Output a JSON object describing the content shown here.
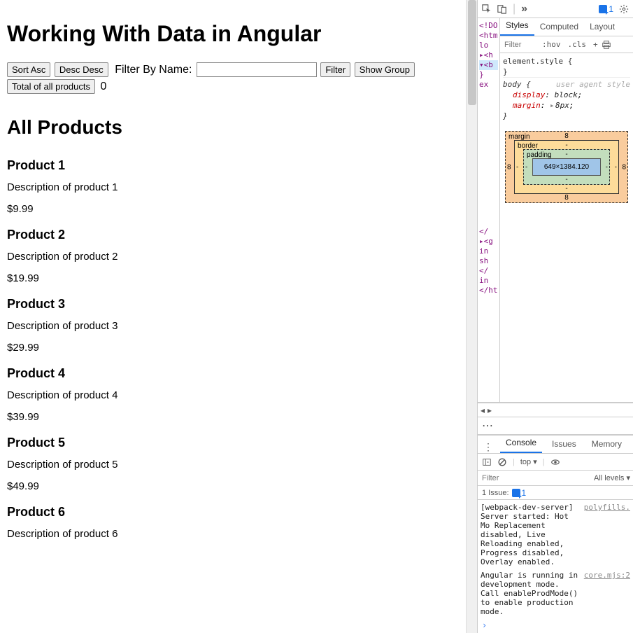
{
  "page": {
    "title": "Working With Data in Angular",
    "buttons": {
      "sortAsc": "Sort Asc",
      "sortDesc": "Desc Desc",
      "filter": "Filter",
      "showGroup": "Show Group",
      "total": "Total of all products"
    },
    "filterLabel": "Filter By Name:",
    "filterValue": "",
    "totalValue": "0",
    "heading": "All Products",
    "products": [
      {
        "name": "Product 1",
        "desc": "Description of product 1",
        "price": "$9.99"
      },
      {
        "name": "Product 2",
        "desc": "Description of product 2",
        "price": "$19.99"
      },
      {
        "name": "Product 3",
        "desc": "Description of product 3",
        "price": "$29.99"
      },
      {
        "name": "Product 4",
        "desc": "Description of product 4",
        "price": "$39.99"
      },
      {
        "name": "Product 5",
        "desc": "Description of product 5",
        "price": "$49.99"
      },
      {
        "name": "Product 6",
        "desc": "Description of product 6",
        "price": ""
      }
    ]
  },
  "devtools": {
    "issueCount": "1",
    "styleTabs": {
      "styles": "Styles",
      "computed": "Computed",
      "layout": "Layout"
    },
    "filterPlaceholder": "Filter",
    "hov": ":hov",
    "cls": ".cls",
    "elementStyle": "element.style {",
    "closeBrace": "}",
    "bodySel": "body {",
    "uas": "user agent style",
    "propDisplay": "display",
    "valDisplay": "block",
    "propMargin": "margin",
    "valMargin": "8px",
    "boxmodel": {
      "margin": "margin",
      "border": "border",
      "padding": "padding",
      "mTop": "8",
      "mBot": "8",
      "mL": "8",
      "mR": "8",
      "bTop": "-",
      "bBot": "-",
      "bL": "-",
      "bR": "-",
      "pTop": "-",
      "pBot": "-",
      "pL": "-",
      "pR": "-",
      "content": "649×1384.120"
    },
    "elLines": [
      "<!DO",
      "<htm",
      "  lo",
      " ▸<h",
      " ▾<b",
      " }",
      "  ex",
      "",
      "",
      "",
      "",
      "",
      "",
      "",
      "",
      "",
      "",
      "",
      "",
      "",
      "",
      "  </",
      " ▸<g",
      "  in",
      "  sh",
      "  </",
      "  in",
      "</ht"
    ],
    "drawerTabs": {
      "console": "Console",
      "issues": "Issues",
      "memory": "Memory"
    },
    "ctx": "top",
    "consoleFilterPlaceholder": "Filter",
    "levels": "All levels",
    "issuesRow": "1 Issue:",
    "issuesCount": "1",
    "msg1": "[webpack-dev-server] Server started: Hot Mo Replacement disabled, Live Reloading enabled, Progress disabled, Overlay enabled.",
    "src1": "polyfills.",
    "msg2": "Angular is running in development mode. Call enableProdMode() to enable production mode.",
    "src2": "core.mjs:2"
  }
}
